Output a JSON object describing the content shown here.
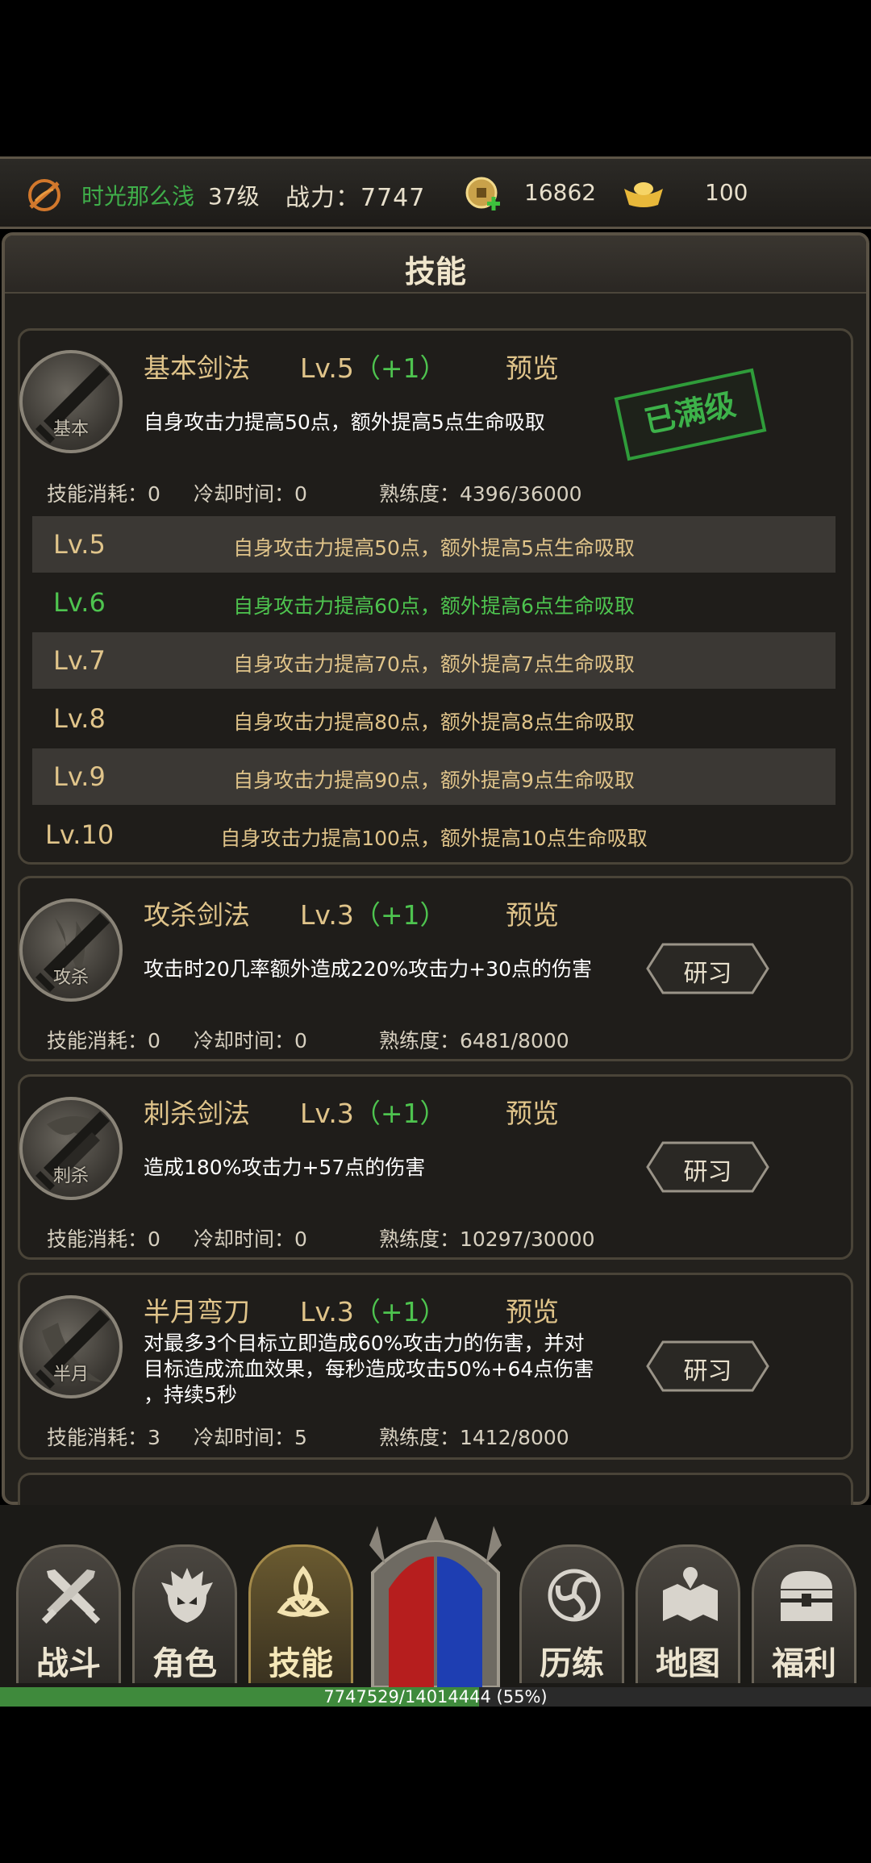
{
  "header": {
    "player_name": "时光那么浅",
    "level": "37级",
    "power": "战力：7747",
    "coins": "16862",
    "gold": "100"
  },
  "panel": {
    "title": "技能"
  },
  "skills": [
    {
      "name": "基本剑法",
      "lv": "Lv.5",
      "plus": "（+1）",
      "preview": "预览",
      "desc": "自身攻击力提高50点，额外提高5点生命吸取",
      "icon_label": "基本",
      "status": "已满级",
      "cost": "技能消耗：0",
      "cooldown": "冷却时间：0",
      "mastery": "熟练度：4396/36000",
      "levels": [
        {
          "lv": "Lv.5",
          "desc": "自身攻击力提高50点，额外提高5点生命吸取"
        },
        {
          "lv": "Lv.6",
          "desc": "自身攻击力提高60点，额外提高6点生命吸取"
        },
        {
          "lv": "Lv.7",
          "desc": "自身攻击力提高70点，额外提高7点生命吸取"
        },
        {
          "lv": "Lv.8",
          "desc": "自身攻击力提高80点，额外提高8点生命吸取"
        },
        {
          "lv": "Lv.9",
          "desc": "自身攻击力提高90点，额外提高9点生命吸取"
        },
        {
          "lv": "Lv.10",
          "desc": "自身攻击力提高100点，额外提高10点生命吸取"
        }
      ]
    },
    {
      "name": "攻杀剑法",
      "lv": "Lv.3",
      "plus": "（+1）",
      "preview": "预览",
      "desc": "攻击时20几率额外造成220%攻击力+30点的伤害",
      "icon_label": "攻杀",
      "button": "研习",
      "cost": "技能消耗：0",
      "cooldown": "冷却时间：0",
      "mastery": "熟练度：6481/8000"
    },
    {
      "name": "刺杀剑法",
      "lv": "Lv.3",
      "plus": "（+1）",
      "preview": "预览",
      "desc": "造成180%攻击力+57点的伤害",
      "icon_label": "刺杀",
      "button": "研习",
      "cost": "技能消耗：0",
      "cooldown": "冷却时间：0",
      "mastery": "熟练度：10297/30000"
    },
    {
      "name": "半月弯刀",
      "lv": "Lv.3",
      "plus": "（+1）",
      "preview": "预览",
      "desc_lines": [
        "对最多3个目标立即造成60%攻击力的伤害，并对",
        "目标造成流血效果，每秒造成攻击50%+64点伤害",
        "，持续5秒"
      ],
      "icon_label": "半月",
      "button": "研习",
      "cost": "技能消耗：3",
      "cooldown": "冷却时间：5",
      "mastery": "熟练度：1412/8000"
    }
  ],
  "tabs": [
    {
      "label": "战斗",
      "icon": "crossed-swords-icon"
    },
    {
      "label": "角色",
      "icon": "helmet-icon"
    },
    {
      "label": "技能",
      "icon": "triquetra-icon",
      "active": true
    },
    {
      "label": "历练",
      "icon": "spiral-icon"
    },
    {
      "label": "地图",
      "icon": "map-icon"
    },
    {
      "label": "福利",
      "icon": "chest-icon"
    }
  ],
  "progress": {
    "text": "7747529/14014444 (55%)",
    "fraction": 0.55
  },
  "colors": {
    "accent": "#e0c48a",
    "green": "#4ec44f",
    "name_green": "#3fae4a"
  }
}
